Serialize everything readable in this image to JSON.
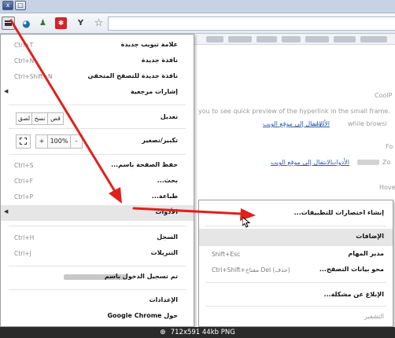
{
  "window": {
    "buttons": [
      "x",
      "□"
    ]
  },
  "toolbar": {
    "menu_icon": "menu-icon",
    "extensions": [
      "globe-icon",
      "person-icon",
      "red-square-icon",
      "y-icon"
    ],
    "star_icon": "☆",
    "ext3_glyph": "✱",
    "ext4_glyph": "Y",
    "ext1_glyph": "◕",
    "ext2_glyph": "♟"
  },
  "page": {
    "title_cool": "CoolP",
    "desc": "you to see quick preview of the hyperlink in the small frame.",
    "row1_while": "while browsi",
    "row1_links": [
      "الأدوات",
      "الانتقال إلى موقع الويب"
    ],
    "row2_fo": "Fo",
    "row2_zo": "Zo",
    "row2_links": [
      "الأدوات",
      "الانتقال إلى موقع الويب"
    ],
    "hove": "Hove"
  },
  "main_menu": {
    "items": [
      {
        "label": "علامة تبويب جديدة",
        "shortcut": "Ctrl+T"
      },
      {
        "label": "نافذة جديدة",
        "shortcut": "Ctrl+N"
      },
      {
        "label": "نافذة جديدة للتصفح المتخفي",
        "shortcut": "Ctrl+Shift+N"
      },
      {
        "label": "إشارات مرجعية",
        "shortcut": ""
      },
      {
        "label": "تعديل",
        "shortcut": ""
      },
      {
        "label": "تكبير/تصغير",
        "shortcut": ""
      },
      {
        "label": "حفظ الصفحة باسم...",
        "shortcut": "Ctrl+S"
      },
      {
        "label": "بحث...",
        "shortcut": "Ctrl+F"
      },
      {
        "label": "طباعة...",
        "shortcut": "Ctrl+P"
      },
      {
        "label": "الأدوات",
        "shortcut": ""
      },
      {
        "label": "السجل",
        "shortcut": "Ctrl+H"
      },
      {
        "label": "التنزيلات",
        "shortcut": "Ctrl+J"
      },
      {
        "label": "تم تسجيل الدخول باسم",
        "shortcut": ""
      },
      {
        "label": "الإعدادات",
        "shortcut": ""
      },
      {
        "label": "حول Google Chrome",
        "shortcut": ""
      }
    ],
    "edit_buttons": [
      "قص",
      "نسخ",
      "لصق"
    ],
    "zoom": {
      "minus": "-",
      "value": "100%",
      "plus": "+"
    }
  },
  "sub_menu": {
    "items": [
      {
        "label": "إنشاء اختصارات للتطبيقات...",
        "shortcut": ""
      },
      {
        "label": "الإضافات",
        "shortcut": ""
      },
      {
        "label": "مدير المهام",
        "shortcut": "Shift+Esc"
      },
      {
        "label": "محو بيانات التصفح...",
        "shortcut": "Ctrl+Shift+مفتاح Del (حذف)"
      },
      {
        "label": "الإبلاغ عن مشكلة...",
        "shortcut": ""
      },
      {
        "label": "التشفير",
        "shortcut": ""
      }
    ]
  },
  "caption": {
    "text": "712x591  44kb  PNG"
  },
  "colors": {
    "arrow": "#e0201c",
    "highlight": "#e6e6e6",
    "caption_bg": "#2a2a2a"
  }
}
